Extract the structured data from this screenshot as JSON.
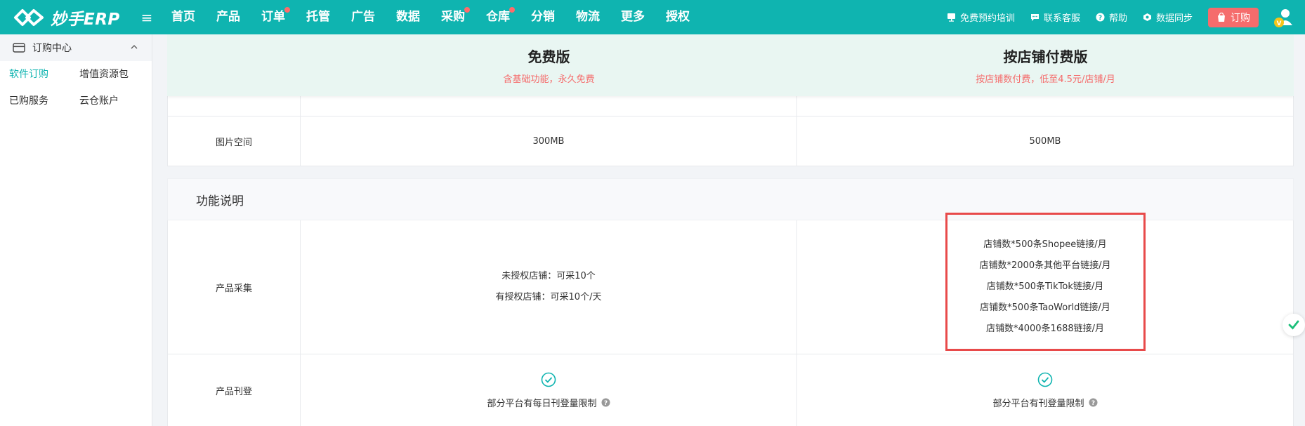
{
  "app": {
    "logo_text": "妙手ERP"
  },
  "nav": [
    {
      "label": "首页",
      "dot": false
    },
    {
      "label": "产品",
      "dot": false
    },
    {
      "label": "订单",
      "dot": true
    },
    {
      "label": "托管",
      "dot": false
    },
    {
      "label": "广告",
      "dot": false
    },
    {
      "label": "数据",
      "dot": false
    },
    {
      "label": "采购",
      "dot": true
    },
    {
      "label": "仓库",
      "dot": true
    },
    {
      "label": "分销",
      "dot": false
    },
    {
      "label": "物流",
      "dot": false
    },
    {
      "label": "更多",
      "dot": false
    },
    {
      "label": "授权",
      "dot": false
    }
  ],
  "top_right": {
    "training": "免费预约培训",
    "support": "联系客服",
    "help": "帮助",
    "sync": "数据同步",
    "order": "订购"
  },
  "sidebar": {
    "title": "订购中心",
    "items": [
      "软件订购",
      "增值资源包",
      "已购服务",
      "云仓账户"
    ],
    "active": "软件订购"
  },
  "plans": {
    "free": {
      "name": "免费版",
      "desc": "含基础功能，永久免费"
    },
    "paid": {
      "name": "按店铺付费版",
      "desc": "按店铺数付费，低至4.5元/店铺/月"
    }
  },
  "rows": {
    "image_space": {
      "label": "图片空间",
      "free": "300MB",
      "paid": "500MB"
    }
  },
  "section": {
    "title": "功能说明"
  },
  "features": {
    "collect": {
      "label": "产品采集",
      "free": [
        "未授权店铺：可采10个",
        "有授权店铺：可采10个/天"
      ],
      "paid": [
        "店铺数*500条Shopee链接/月",
        "店铺数*2000条其他平台链接/月",
        "店铺数*500条TikTok链接/月",
        "店铺数*500条TaoWorld链接/月",
        "店铺数*4000条1688链接/月"
      ]
    },
    "publish": {
      "label": "产品刊登",
      "free": "部分平台有每日刊登量限制",
      "paid": "部分平台有刊登量限制"
    }
  },
  "colors": {
    "brand": "#0fb4b0",
    "accent_red": "#f56c6c",
    "highlight": "#e84a4a"
  }
}
